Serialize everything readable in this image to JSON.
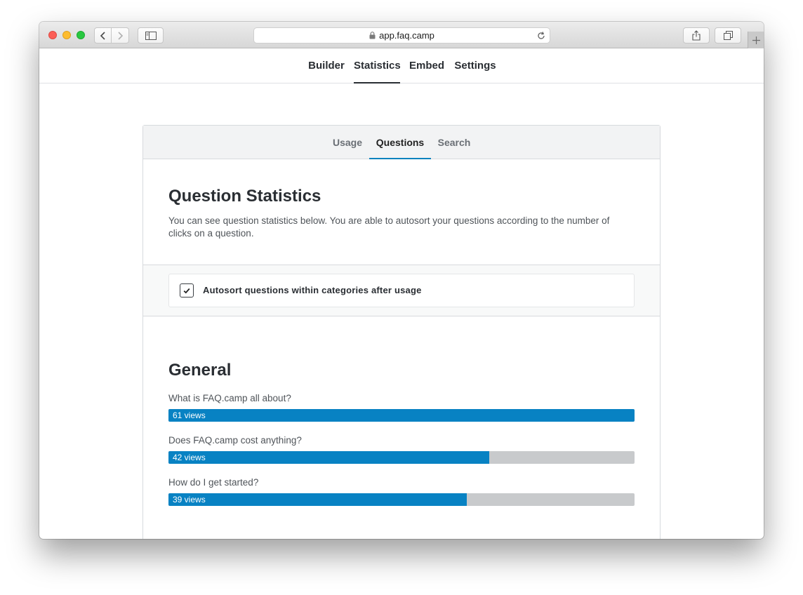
{
  "browser": {
    "url": "app.faq.camp"
  },
  "app_nav": {
    "items": [
      {
        "label": "Builder",
        "active": false
      },
      {
        "label": "Statistics",
        "active": true
      },
      {
        "label": "Embed",
        "active": false
      },
      {
        "label": "Settings",
        "active": false
      }
    ]
  },
  "stats_tabs": {
    "items": [
      {
        "label": "Usage",
        "active": false
      },
      {
        "label": "Questions",
        "active": true
      },
      {
        "label": "Search",
        "active": false
      }
    ]
  },
  "question_stats": {
    "title": "Question Statistics",
    "description": "You can see question statistics below. You are able to autosort your questions according to the number of clicks on a question."
  },
  "autosort": {
    "label": "Autosort questions within categories after usage",
    "checked": true
  },
  "category": {
    "title": "General",
    "questions": [
      {
        "question": "What is FAQ.camp all about?",
        "views": 61,
        "views_label": "61 views"
      },
      {
        "question": "Does FAQ.camp cost anything?",
        "views": 42,
        "views_label": "42 views"
      },
      {
        "question": "How do I get started?",
        "views": 39,
        "views_label": "39 views"
      }
    ]
  },
  "colors": {
    "accent": "#0882c3",
    "bar_track": "#c8cacc"
  }
}
